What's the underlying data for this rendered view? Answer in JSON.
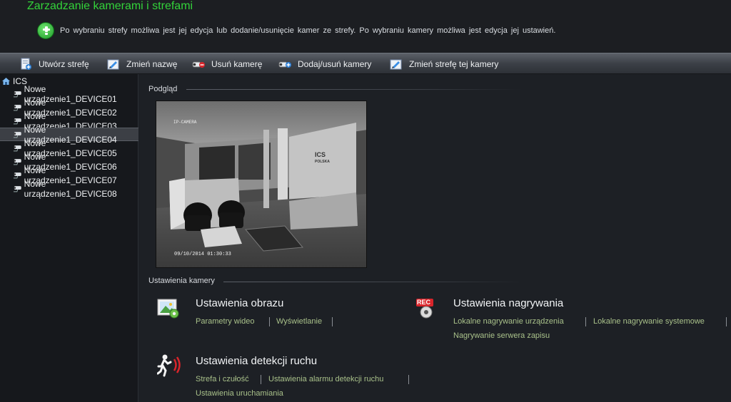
{
  "header": {
    "title": "Zarzadzanie kamerami i strefami",
    "info": "Po wybraniu strefy możliwa jest jej edycja lub dodanie/usunięcie kamer ze strefy. Po wybraniu kamery możliwa jest edycja jej ustawień."
  },
  "toolbar": {
    "create_zone": "Utwórz strefę",
    "rename": "Zmień nazwę",
    "remove_camera": "Usuń kamerę",
    "add_remove_cameras": "Dodaj/usuń kamery",
    "change_zone": "Zmień strefę tej kamery"
  },
  "tree": {
    "root": "ICS",
    "items": [
      "Nowe urządzenie1_DEVICE01",
      "Nowe urządzenie1_DEVICE02",
      "Nowe urządzenie1_DEVICE03",
      "Nowe urządzenie1_DEVICE04",
      "Nowe urządzenie1_DEVICE05",
      "Nowe urządzenie1_DEVICE06",
      "Nowe urządzenie1_DEVICE07",
      "Nowe urządzenie1_DEVICE08"
    ],
    "selected": "Nowe urządzenie1_DEVICE04"
  },
  "preview": {
    "label": "Podgląd",
    "osd_camera": "IP-CAMERA",
    "osd_timestamp": "09/10/2014 01:30:33",
    "wall_logo": "ICS",
    "wall_logo_sub": "POLSKA"
  },
  "settings": {
    "label": "Ustawienia kamery",
    "image": {
      "title": "Ustawienia obrazu",
      "links": [
        "Parametry wideo",
        "Wyświetlanie"
      ]
    },
    "recording": {
      "title": "Ustawienia nagrywania",
      "icon_text": "REC",
      "links": [
        "Lokalne nagrywanie urządzenia",
        "Lokalne nagrywanie systemowe",
        "Nagrywanie serwera zapisu"
      ]
    },
    "motion": {
      "title": "Ustawienia detekcji ruchu",
      "links": [
        "Strefa i czułość",
        "Ustawienia alarmu detekcji ruchu",
        "Ustawienia uruchamiania"
      ]
    }
  },
  "colors": {
    "title_green": "#33d33a",
    "link_green": "#a9c18a",
    "rec_red": "#d9252b"
  }
}
